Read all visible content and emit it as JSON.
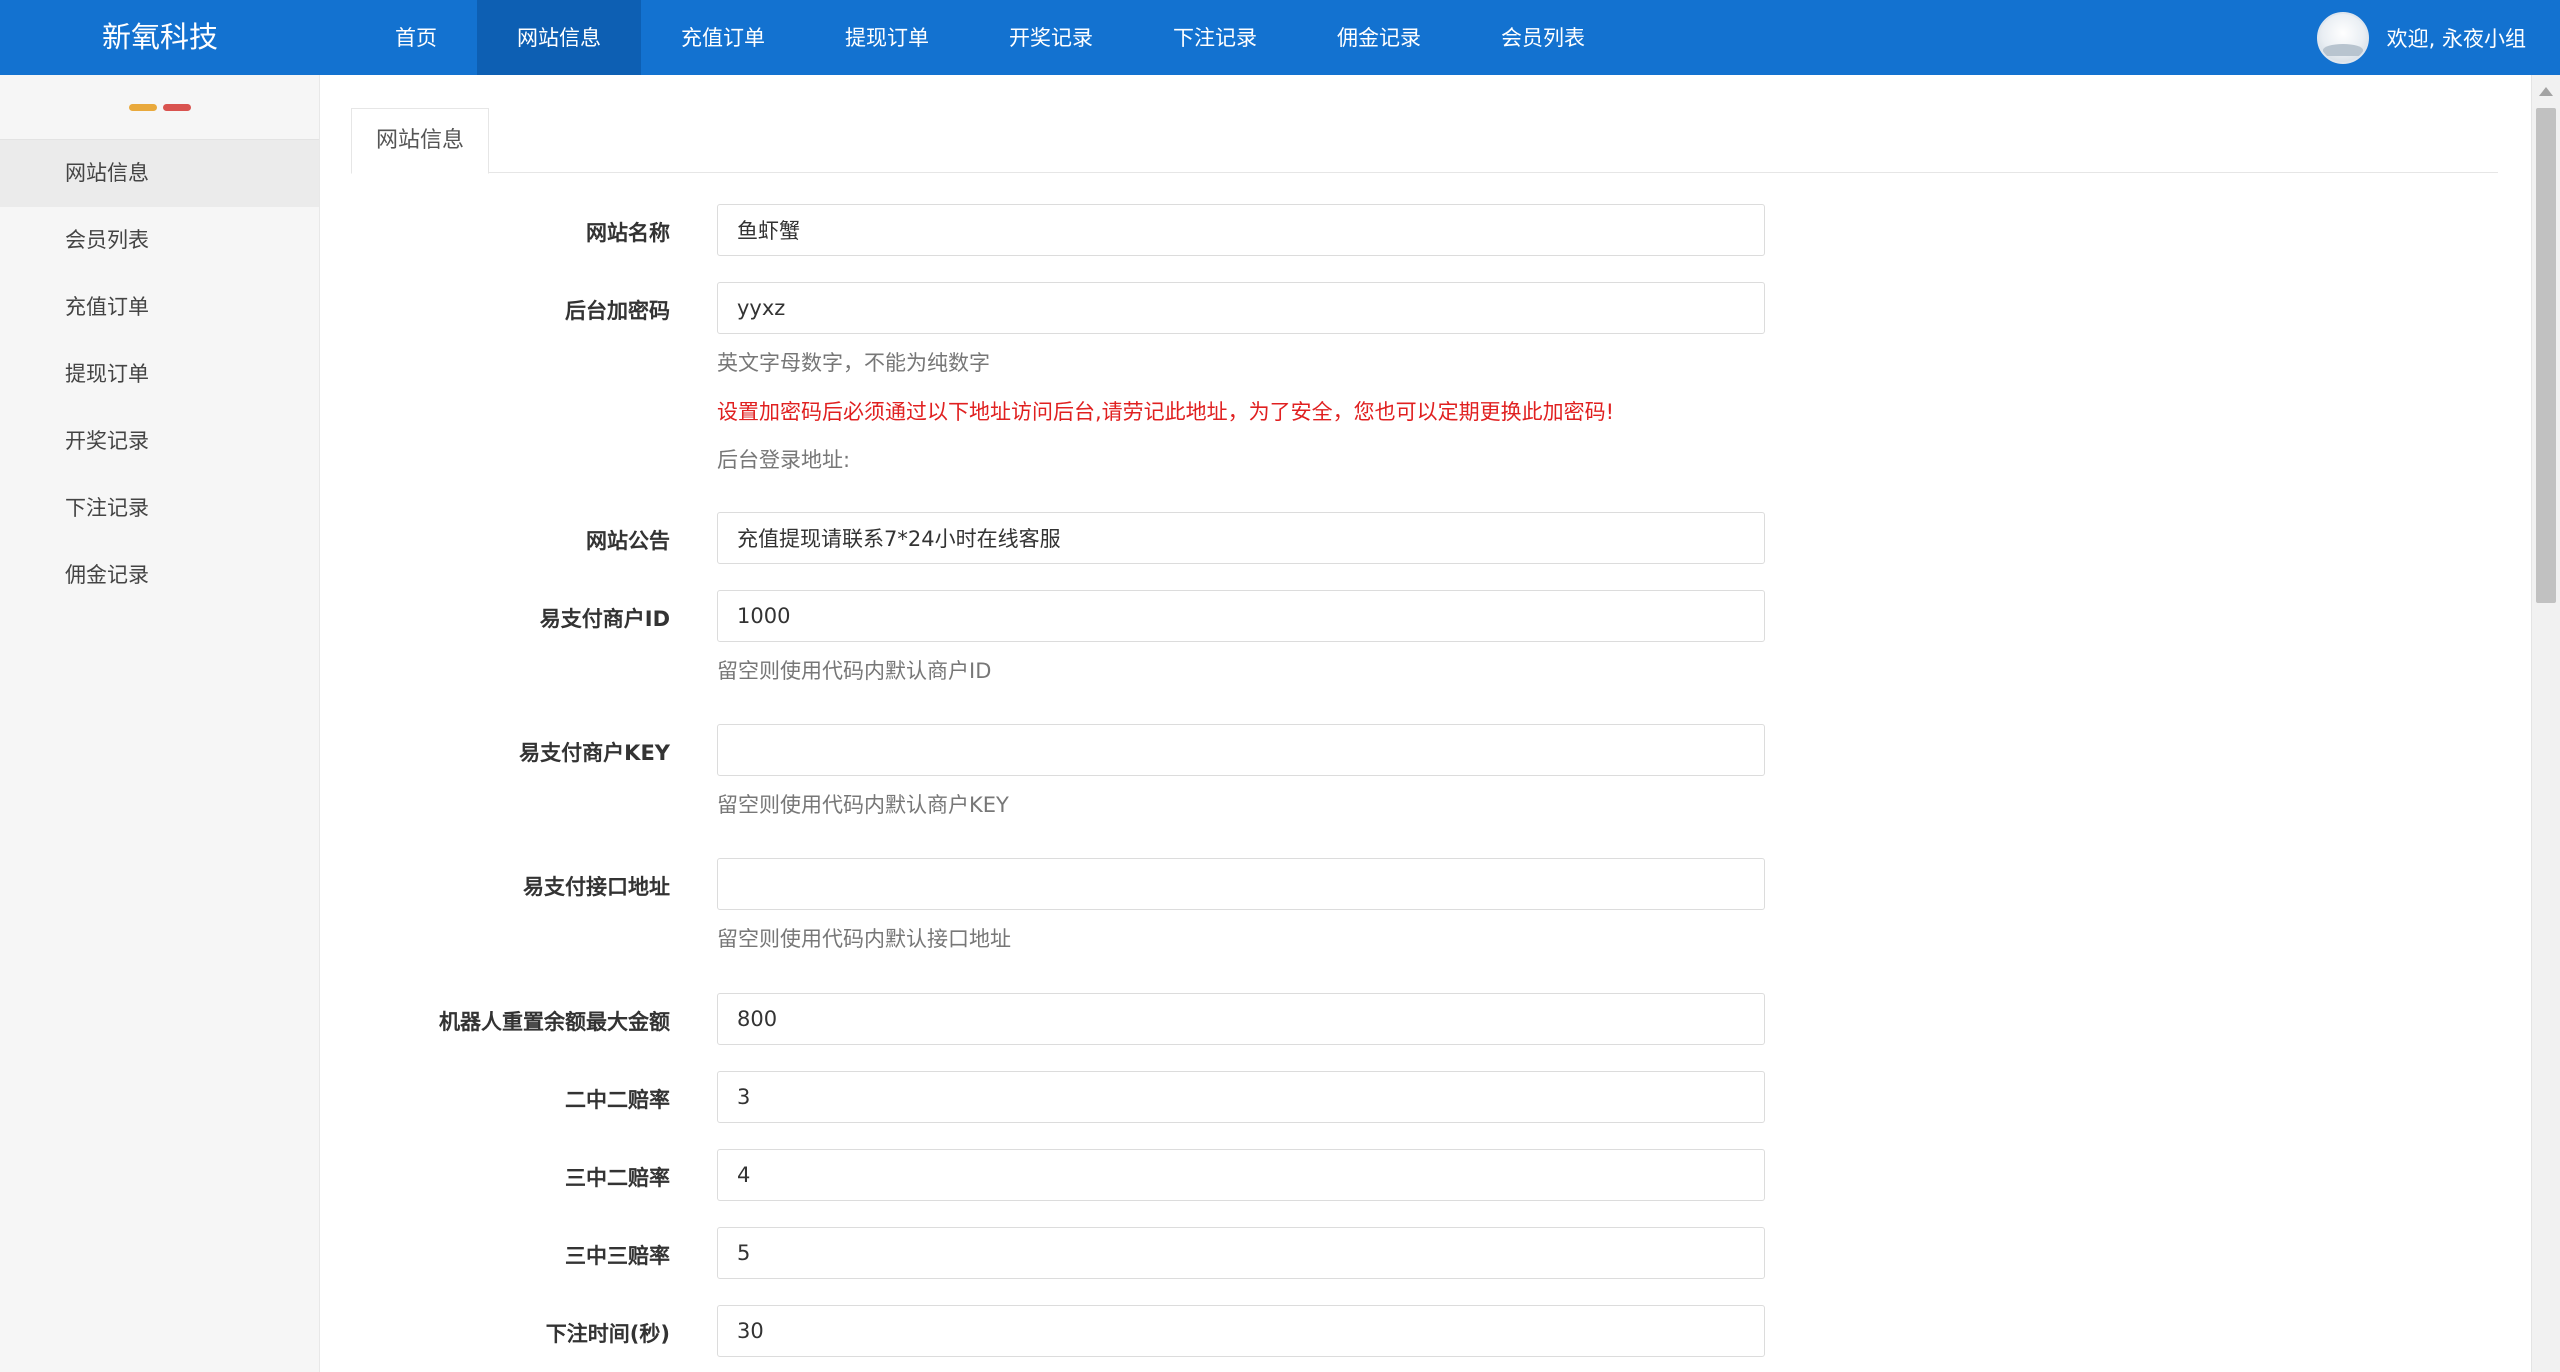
{
  "brand": "新氧科技",
  "nav": {
    "items": [
      "首页",
      "网站信息",
      "充值订单",
      "提现订单",
      "开奖记录",
      "下注记录",
      "佣金记录",
      "会员列表"
    ],
    "active_index": 1
  },
  "user": {
    "greeting": "欢迎, 永夜小组"
  },
  "sidebar": {
    "items": [
      "网站信息",
      "会员列表",
      "充值订单",
      "提现订单",
      "开奖记录",
      "下注记录",
      "佣金记录"
    ],
    "active_index": 0
  },
  "tab": {
    "label": "网站信息"
  },
  "form": {
    "site_name": {
      "label": "网站名称",
      "value": "鱼虾蟹"
    },
    "admin_password": {
      "label": "后台加密码",
      "value": "yyxz",
      "hint": "英文字母数字，不能为纯数字",
      "warning": "设置加密码后必须通过以下地址访问后台,请劳记此地址，为了安全，您也可以定期更换此加密码!",
      "login_address_label": "后台登录地址:"
    },
    "announcement": {
      "label": "网站公告",
      "value": "充值提现请联系7*24小时在线客服"
    },
    "merchant_id": {
      "label": "易支付商户ID",
      "value": "1000",
      "hint": "留空则使用代码内默认商户ID"
    },
    "merchant_key": {
      "label": "易支付商户KEY",
      "value": "",
      "hint": "留空则使用代码内默认商户KEY"
    },
    "api_url": {
      "label": "易支付接口地址",
      "value": "",
      "hint": "留空则使用代码内默认接口地址"
    },
    "robot_max_amount": {
      "label": "机器人重置余额最大金额",
      "value": "800"
    },
    "odds_2of2": {
      "label": "二中二赔率",
      "value": "3"
    },
    "odds_3of2": {
      "label": "三中二赔率",
      "value": "4"
    },
    "odds_3of3": {
      "label": "三中三赔率",
      "value": "5"
    },
    "bet_time": {
      "label": "下注时间(秒)",
      "value": "30"
    }
  },
  "colors": {
    "topbar": "#1372d0",
    "nav_active": "#0d5fb3",
    "warning": "#e02020",
    "toggle_yellow": "#e9a93c",
    "toggle_red": "#d9534f"
  }
}
